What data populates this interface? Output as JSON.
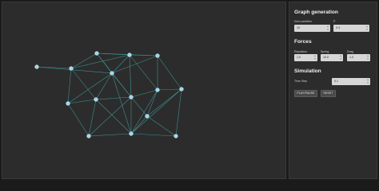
{
  "graph": {
    "node_color": "#9fd8ef",
    "edge_color": "#3f8f8f"
  },
  "sidebar": {
    "graph_generation": {
      "title": "Graph generation",
      "num_particles_label": "Num particles",
      "num_particles_value": "10",
      "p_label": "P",
      "p_value": "0.3"
    },
    "forces": {
      "title": "Forces",
      "repulsion_label": "Repulsion",
      "repulsion_value": "1.0",
      "spring_label": "Spring",
      "spring_value": "10.0",
      "drag_label": "Drag",
      "drag_value": "1.0"
    },
    "simulation": {
      "title": "Simulation",
      "time_step_label": "Time Step",
      "time_step_value": "0.1",
      "play_pause_label": "PLAY/PAUSE",
      "reset_label": "RESET"
    }
  }
}
